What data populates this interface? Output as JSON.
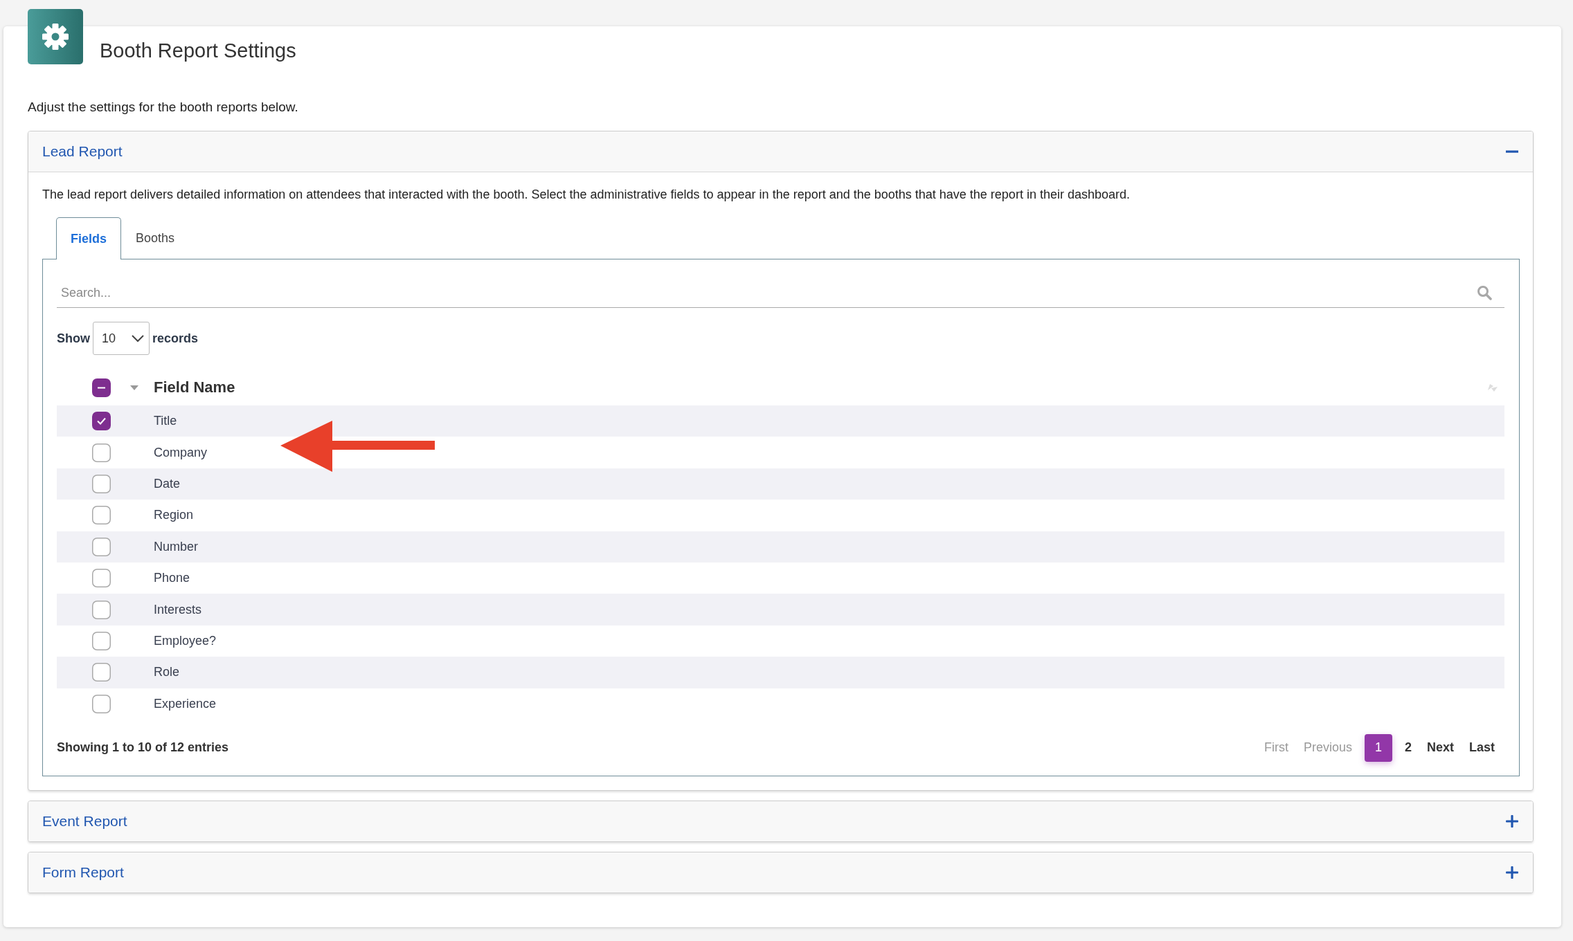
{
  "page": {
    "title": "Booth Report Settings",
    "intro": "Adjust the settings for the booth reports below."
  },
  "sections": [
    {
      "title": "Lead Report",
      "expanded": true,
      "description": "The lead report delivers detailed information on attendees that interacted with the booth. Select the administrative fields to appear in the report and the booths that have the report in their dashboard.",
      "tabs": [
        {
          "label": "Fields",
          "selected": true
        },
        {
          "label": "Booths",
          "selected": false
        }
      ],
      "search": {
        "placeholder": "Search..."
      },
      "page_size": {
        "label_before": "Show",
        "value": "10",
        "label_after": "records"
      },
      "table": {
        "column": "Field Name",
        "select_all": {
          "indeterminate": true
        },
        "rows": [
          {
            "name": "Title",
            "checked": true
          },
          {
            "name": "Company",
            "checked": false
          },
          {
            "name": "Date",
            "checked": false
          },
          {
            "name": "Region",
            "checked": false
          },
          {
            "name": "Number",
            "checked": false
          },
          {
            "name": "Phone",
            "checked": false
          },
          {
            "name": "Interests",
            "checked": false
          },
          {
            "name": "Employee?",
            "checked": false
          },
          {
            "name": "Role",
            "checked": false
          },
          {
            "name": "Experience",
            "checked": false
          }
        ]
      },
      "summary": "Showing 1 to 10 of 12 entries",
      "pagination": [
        {
          "label": "First",
          "disabled": true,
          "selected": false
        },
        {
          "label": "Previous",
          "disabled": true,
          "selected": false
        },
        {
          "label": "1",
          "disabled": false,
          "selected": true
        },
        {
          "label": "2",
          "disabled": false,
          "selected": false
        },
        {
          "label": "Next",
          "disabled": false,
          "selected": false
        },
        {
          "label": "Last",
          "disabled": false,
          "selected": false
        }
      ]
    },
    {
      "title": "Event Report",
      "expanded": false
    },
    {
      "title": "Form Report",
      "expanded": false
    }
  ]
}
